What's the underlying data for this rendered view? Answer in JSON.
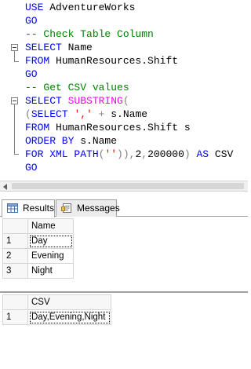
{
  "editor": {
    "lines": [
      {
        "id": "l1",
        "parts": [
          {
            "t": "USE",
            "c": "kw"
          },
          {
            "t": " AdventureWorks",
            "c": "tx"
          }
        ]
      },
      {
        "id": "l2",
        "parts": [
          {
            "t": "GO",
            "c": "kw"
          }
        ]
      },
      {
        "id": "l3",
        "parts": [
          {
            "t": "-- Check Table Column",
            "c": "cm"
          }
        ]
      },
      {
        "id": "l4",
        "parts": [
          {
            "t": "SELECT",
            "c": "kw"
          },
          {
            "t": " Name",
            "c": "tx"
          }
        ]
      },
      {
        "id": "l5",
        "parts": [
          {
            "t": "FROM",
            "c": "kw"
          },
          {
            "t": " HumanResources.Shift",
            "c": "tx"
          }
        ]
      },
      {
        "id": "l6",
        "parts": [
          {
            "t": "GO",
            "c": "kw"
          }
        ]
      },
      {
        "id": "l7",
        "parts": [
          {
            "t": "-- Get CSV values",
            "c": "cm"
          }
        ]
      },
      {
        "id": "l8",
        "parts": [
          {
            "t": "SELECT",
            "c": "kw"
          },
          {
            "t": " ",
            "c": "tx"
          },
          {
            "t": "SUBSTRING",
            "c": "fn"
          },
          {
            "t": "(",
            "c": "gr"
          }
        ]
      },
      {
        "id": "l9",
        "parts": [
          {
            "t": "(",
            "c": "gr"
          },
          {
            "t": "SELECT",
            "c": "kw"
          },
          {
            "t": " ",
            "c": "tx"
          },
          {
            "t": "','",
            "c": "st"
          },
          {
            "t": " + ",
            "c": "gr"
          },
          {
            "t": "s.Name",
            "c": "tx"
          }
        ]
      },
      {
        "id": "l10",
        "parts": [
          {
            "t": "FROM",
            "c": "kw"
          },
          {
            "t": " HumanResources.Shift s",
            "c": "tx"
          }
        ]
      },
      {
        "id": "l11",
        "parts": [
          {
            "t": "ORDER BY",
            "c": "kw"
          },
          {
            "t": " s.Name",
            "c": "tx"
          }
        ]
      },
      {
        "id": "l12",
        "parts": [
          {
            "t": "FOR XML PATH",
            "c": "kw"
          },
          {
            "t": "(",
            "c": "gr"
          },
          {
            "t": "''",
            "c": "st"
          },
          {
            "t": ")),",
            "c": "gr"
          },
          {
            "t": "2",
            "c": "tx"
          },
          {
            "t": ",",
            "c": "gr"
          },
          {
            "t": "200000",
            "c": "tx"
          },
          {
            "t": ") ",
            "c": "gr"
          },
          {
            "t": "AS",
            "c": "kw"
          },
          {
            "t": " CSV",
            "c": "tx"
          }
        ]
      },
      {
        "id": "l13",
        "parts": [
          {
            "t": "GO",
            "c": "kw"
          }
        ]
      }
    ]
  },
  "tabs": {
    "results_label": "Results",
    "messages_label": "Messages"
  },
  "grid1": {
    "header": "Name",
    "rows": [
      {
        "num": "1",
        "value": "Day"
      },
      {
        "num": "2",
        "value": "Evening"
      },
      {
        "num": "3",
        "value": "Night"
      }
    ]
  },
  "grid2": {
    "header": "CSV",
    "rows": [
      {
        "num": "1",
        "value": "Day,Evening,Night"
      }
    ]
  }
}
